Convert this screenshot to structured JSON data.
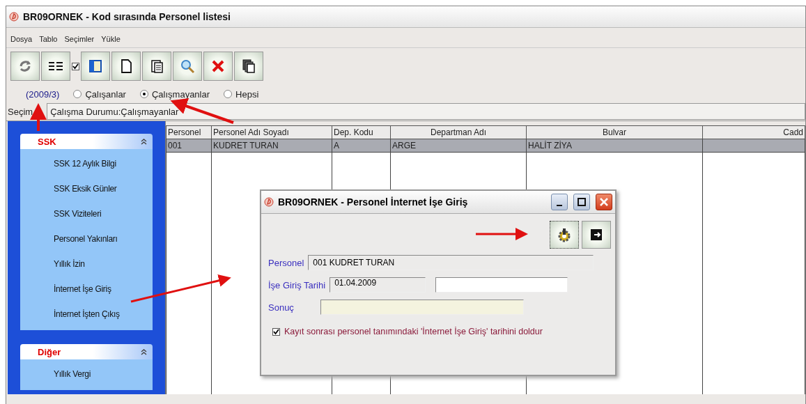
{
  "window": {
    "title": "BR09ORNEK - Kod sırasında Personel listesi"
  },
  "menu": [
    "Dosya",
    "Tablo",
    "Seçimler",
    "Yükle"
  ],
  "toolbar": {
    "checkbox": {
      "checked": true
    }
  },
  "filter": {
    "period": "(2009/3)",
    "options": [
      {
        "label": "Çalışanlar",
        "selected": false
      },
      {
        "label": "Çalışmayanlar",
        "selected": true
      },
      {
        "label": "Hepsi",
        "selected": false
      }
    ]
  },
  "selection": {
    "label": "Seçim",
    "value": "Çalışma Durumu:Çalışmayanlar"
  },
  "sidebar": {
    "groups": [
      {
        "title": "SSK",
        "expanded": true,
        "items": [
          "SSK 12 Aylık Bilgi",
          "SSK Eksik Günler",
          "SSK Viziteleri",
          "Personel Yakınları",
          "Yıllık İzin",
          "İnternet İşe Giriş",
          "İnternet İşten Çıkış"
        ]
      },
      {
        "title": "Diğer",
        "expanded": true,
        "items": [
          "Yıllık Vergi"
        ]
      }
    ]
  },
  "table": {
    "columns": [
      "Personel",
      "Personel Adı Soyadı",
      "Dep. Kodu",
      "Departman Adı",
      "Bulvar",
      "Cadd"
    ],
    "rows": [
      {
        "selected": true,
        "cells": [
          "001",
          "KUDRET TURAN",
          "A",
          "ARGE",
          "HALİT ZİYA"
        ]
      }
    ]
  },
  "dialog": {
    "title": "BR09ORNEK - Personel İnternet İşe Giriş",
    "fields": [
      {
        "label": "Personel",
        "value": "001 KUDRET TURAN"
      },
      {
        "label": "İşe Giriş Tarihi",
        "value": "01.04.2009"
      },
      {
        "label": "Sonuç"
      }
    ],
    "checkbox": {
      "label": "Kayıt sonrası personel tanımındaki 'İnternet İşe Giriş' tarihini doldur",
      "checked": true
    }
  }
}
